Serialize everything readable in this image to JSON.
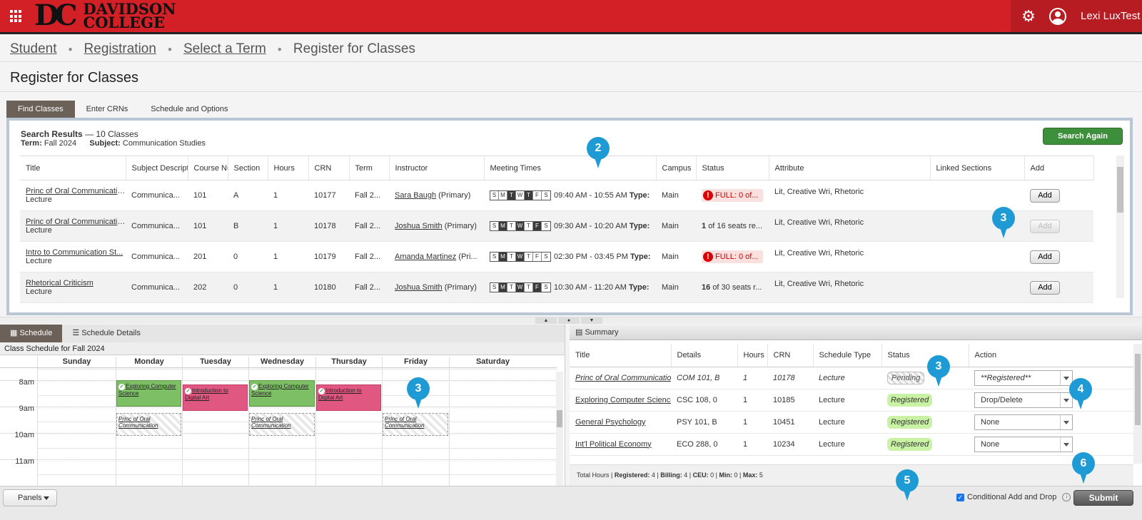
{
  "header": {
    "logo_mark": "DC",
    "logo_line1": "DAVIDSON",
    "logo_line2": "COLLEGE",
    "user_name": "Lexi LuxTest"
  },
  "breadcrumb": [
    "Student",
    "Registration",
    "Select a Term",
    "Register for Classes"
  ],
  "page_title": "Register for Classes",
  "tabs": [
    "Find Classes",
    "Enter CRNs",
    "Schedule and Options"
  ],
  "search": {
    "title": "Search Results",
    "count": "— 10 Classes",
    "term_label": "Term:",
    "term_value": "Fall 2024",
    "subject_label": "Subject:",
    "subject_value": "Communication Studies",
    "search_again": "Search Again"
  },
  "results": {
    "columns": [
      "Title",
      "Subject Description",
      "Course Number",
      "Section",
      "Hours",
      "CRN",
      "Term",
      "Instructor",
      "Meeting Times",
      "Campus",
      "Status",
      "Attribute",
      "Linked Sections",
      "Add"
    ],
    "day_letters": [
      "S",
      "M",
      "T",
      "W",
      "T",
      "F",
      "S"
    ],
    "rows": [
      {
        "title": "Princ of Oral Communication",
        "type": "Lecture",
        "subject": "Communica...",
        "course": "101",
        "section": "A",
        "hours": "1",
        "crn": "10177",
        "term": "Fall 2...",
        "instructor": "Sara Baugh",
        "instructor_role": "(Primary)",
        "days": [
          0,
          0,
          1,
          0,
          1,
          0,
          0
        ],
        "time": "09:40 AM - 10:55 AM",
        "type_label": "Type:",
        "campus": "Main",
        "status_full": true,
        "status": "FULL: 0 of...",
        "status_num": "",
        "attribute": "Lit, Creative Wri, Rhetoric",
        "add": "Add",
        "add_disabled": false
      },
      {
        "title": "Princ of Oral Communication",
        "type": "Lecture",
        "subject": "Communica...",
        "course": "101",
        "section": "B",
        "hours": "1",
        "crn": "10178",
        "term": "Fall 2...",
        "instructor": "Joshua Smith",
        "instructor_role": "(Primary)",
        "days": [
          0,
          1,
          0,
          1,
          0,
          1,
          0
        ],
        "time": "09:30 AM - 10:20 AM",
        "type_label": "Type:",
        "campus": "Main",
        "status_full": false,
        "status_num": "1",
        "status": "of 16 seats re...",
        "attribute": "Lit, Creative Wri, Rhetoric",
        "add": "Add",
        "add_disabled": true
      },
      {
        "title": "Intro to Communication St...",
        "type": "Lecture",
        "subject": "Communica...",
        "course": "201",
        "section": "0",
        "hours": "1",
        "crn": "10179",
        "term": "Fall 2...",
        "instructor": "Amanda Martinez",
        "instructor_role": "(Pri...",
        "days": [
          0,
          1,
          0,
          1,
          0,
          0,
          0
        ],
        "time": "02:30 PM - 03:45 PM",
        "type_label": "Type:",
        "campus": "Main",
        "status_full": true,
        "status": "FULL: 0 of...",
        "status_num": "",
        "attribute": "Lit, Creative Wri, Rhetoric",
        "add": "Add",
        "add_disabled": false
      },
      {
        "title": "Rhetorical Criticism",
        "type": "Lecture",
        "subject": "Communica...",
        "course": "202",
        "section": "0",
        "hours": "1",
        "crn": "10180",
        "term": "Fall 2...",
        "instructor": "Joshua Smith",
        "instructor_role": "(Primary)",
        "days": [
          0,
          1,
          0,
          1,
          0,
          1,
          0
        ],
        "time": "10:30 AM - 11:20 AM",
        "type_label": "Type:",
        "campus": "Main",
        "status_full": false,
        "status_num": "16",
        "status": "of 30 seats r...",
        "attribute": "Lit, Creative Wri, Rhetoric",
        "add": "Add",
        "add_disabled": false
      }
    ]
  },
  "schedule": {
    "tabs": [
      "Schedule",
      "Schedule Details"
    ],
    "title": "Class Schedule for Fall 2024",
    "days": [
      "Sunday",
      "Monday",
      "Tuesday",
      "Wednesday",
      "Thursday",
      "Friday",
      "Saturday"
    ],
    "hours": [
      "8am",
      "9am",
      "10am",
      "11am"
    ],
    "events": [
      {
        "day": 1,
        "start": 8.0,
        "end": 9.0,
        "label": "Exploring Computer Science",
        "style": "green"
      },
      {
        "day": 3,
        "start": 8.0,
        "end": 9.0,
        "label": "Exploring Computer Science",
        "style": "green"
      },
      {
        "day": 2,
        "start": 8.17,
        "end": 9.17,
        "label": "Introduction to Digital Art",
        "style": "pink"
      },
      {
        "day": 4,
        "start": 8.17,
        "end": 9.17,
        "label": "Introduction to Digital Art",
        "style": "pink"
      },
      {
        "day": 1,
        "start": 9.25,
        "end": 10.1,
        "label": "Princ of Oral Communication",
        "style": "hatch"
      },
      {
        "day": 3,
        "start": 9.25,
        "end": 10.1,
        "label": "Princ of Oral Communication",
        "style": "hatch"
      },
      {
        "day": 5,
        "start": 9.25,
        "end": 10.1,
        "label": "Princ of Oral Communication",
        "style": "hatch"
      }
    ]
  },
  "summary": {
    "title": "Summary",
    "columns": [
      "Title",
      "Details",
      "Hours",
      "CRN",
      "Schedule Type",
      "Status",
      "Action"
    ],
    "rows": [
      {
        "title": "Princ of Oral Communication",
        "details": "COM 101, B",
        "hours": "1",
        "crn": "10178",
        "type": "Lecture",
        "status": "Pending",
        "action": "**Registered**",
        "pending": true
      },
      {
        "title": "Exploring Computer Science",
        "details": "CSC 108, 0",
        "hours": "1",
        "crn": "10185",
        "type": "Lecture",
        "status": "Registered",
        "action": "Drop/Delete",
        "pending": false
      },
      {
        "title": "General Psychology",
        "details": "PSY 101, B",
        "hours": "1",
        "crn": "10451",
        "type": "Lecture",
        "status": "Registered",
        "action": "None",
        "pending": false
      },
      {
        "title": "Int'l Political Economy",
        "details": "ECO 288, 0",
        "hours": "1",
        "crn": "10234",
        "type": "Lecture",
        "status": "Registered",
        "action": "None",
        "pending": false
      }
    ],
    "footer": {
      "total_label": "Total Hours |",
      "reg_label": "Registered:",
      "reg": "4",
      "billing_label": "Billing:",
      "billing": "4",
      "ceu_label": "CEU:",
      "ceu": "0",
      "min_label": "Min:",
      "min": "0",
      "max_label": "Max:",
      "max": "5"
    }
  },
  "bottom": {
    "panels": "Panels",
    "conditional": "Conditional Add and Drop",
    "submit": "Submit"
  },
  "markers": [
    "2",
    "3",
    "3",
    "3",
    "4",
    "5",
    "6"
  ],
  "colors": {
    "brand_red": "#d32027",
    "marker_blue": "#1e9bd4",
    "green_button": "#3d8f3b"
  }
}
